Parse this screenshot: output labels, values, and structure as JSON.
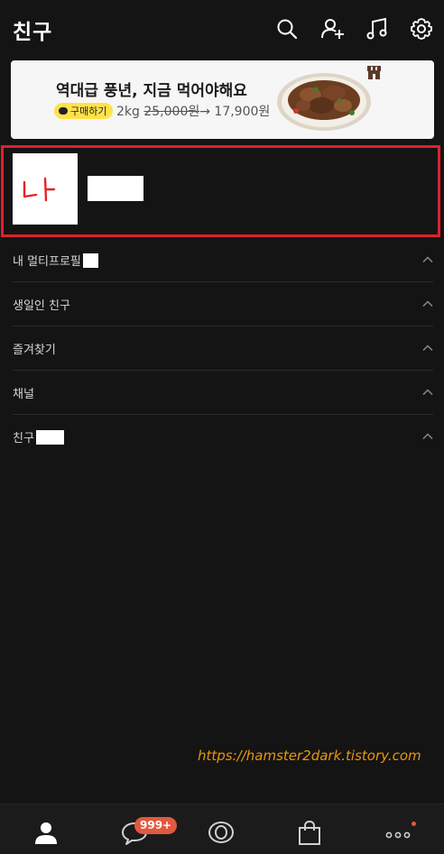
{
  "header": {
    "title": "친구",
    "icons": [
      "search-icon",
      "add-friend-icon",
      "music-icon",
      "settings-icon"
    ]
  },
  "ad": {
    "headline": "역대급 풍년, 지금 먹어야해요",
    "badge_label": "구매하기",
    "price_weight": "2kg",
    "price_original": "25,000원",
    "price_arrow": "→",
    "price_sale": "17,900원",
    "badge_color": "#ffe24a"
  },
  "profile": {
    "avatar_text": "나",
    "highlight_color": "#e0202a"
  },
  "sections": [
    {
      "label": "내 멀티프로필"
    },
    {
      "label": "생일인 친구"
    },
    {
      "label": "즐겨찾기"
    },
    {
      "label": "채널"
    },
    {
      "label": "친구"
    }
  ],
  "watermark": "https://hamster2dark.tistory.com",
  "tabbar": {
    "tabs": [
      "friends-icon",
      "chat-icon",
      "view-icon",
      "shopping-icon",
      "more-icon"
    ],
    "chat_badge": "999+",
    "accent": "#e2593f"
  }
}
